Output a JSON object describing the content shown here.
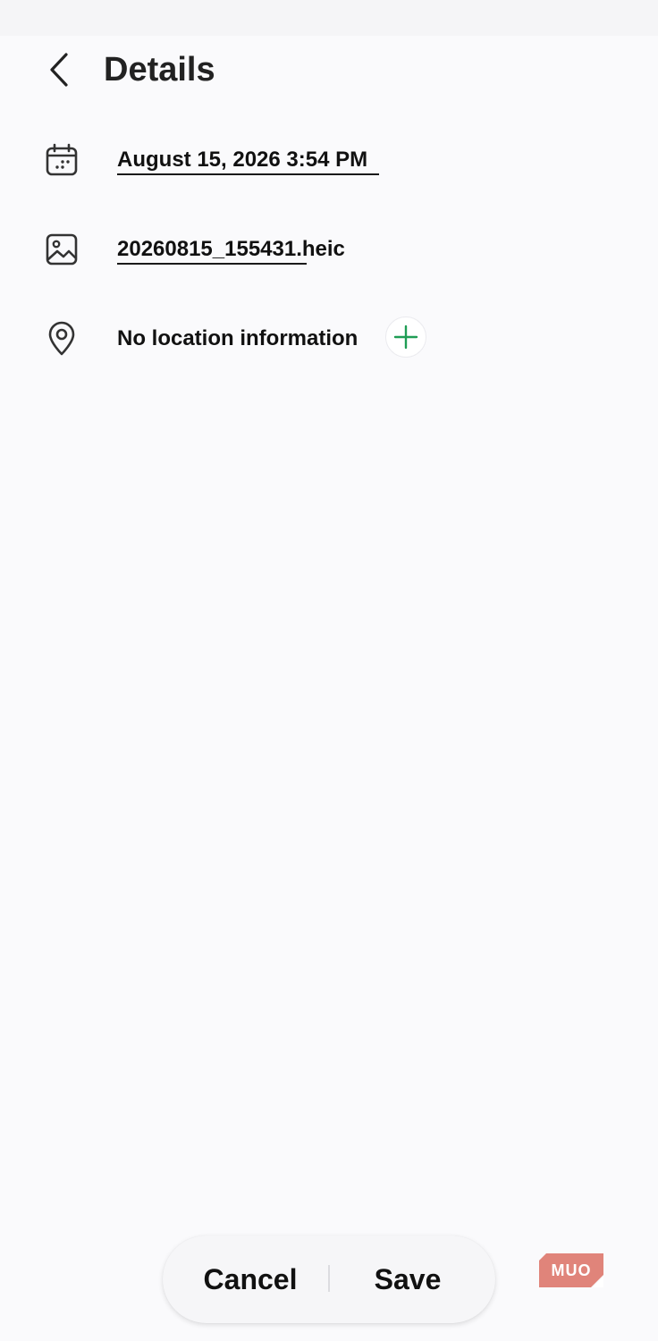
{
  "header": {
    "title": "Details",
    "back_icon": "chevron-left-icon"
  },
  "details": {
    "date_time": {
      "icon": "calendar-icon",
      "value": "August 15, 2026 3:54 PM"
    },
    "file_name": {
      "icon": "image-icon",
      "value": "20260815_155431.heic"
    },
    "location": {
      "icon": "location-pin-icon",
      "value": "No location information",
      "add_icon": "plus-icon"
    }
  },
  "actions": {
    "cancel_label": "Cancel",
    "save_label": "Save"
  },
  "watermark": {
    "text": "MUO"
  },
  "colors": {
    "background": "#fafafc",
    "text": "#111111",
    "accent_green": "#1f9d55",
    "watermark": "#e0847a"
  }
}
